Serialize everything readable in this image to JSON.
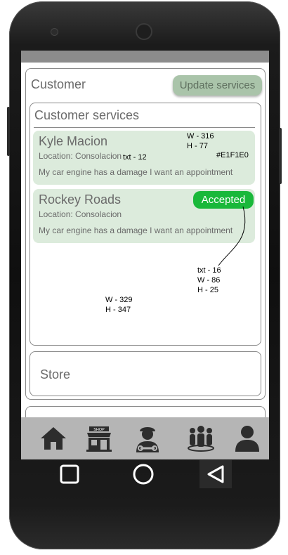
{
  "header": {
    "title": "Customer",
    "update_button": "Update services"
  },
  "services": {
    "title": "Customer services",
    "cards": [
      {
        "name": "Kyle Macion",
        "location": "Location: Consolacion",
        "message": "My car engine has a damage I want an appointment"
      },
      {
        "name": "Rockey Roads",
        "location": "Location: Consolacion",
        "message": "My car engine has a damage I want an appointment",
        "status": "Accepted"
      }
    ]
  },
  "annotations": {
    "card_size": "W - 316\nH - 77",
    "card_text": "txt - 12",
    "card_color": "#E1F1E0",
    "badge_spec": "txt - 16\nW - 86\nH - 25",
    "box_size": "W - 329\nH - 347"
  },
  "store": {
    "label": "Store"
  },
  "bottom_nav": [
    {
      "icon": "home-icon"
    },
    {
      "icon": "shop-icon",
      "label": "SHOP"
    },
    {
      "icon": "mechanic-icon"
    },
    {
      "icon": "group-icon"
    },
    {
      "icon": "user-icon"
    }
  ],
  "colors": {
    "card_bg": "#E1F1E0",
    "accepted": "#19B83A",
    "update_button": "#AAC4AA"
  }
}
